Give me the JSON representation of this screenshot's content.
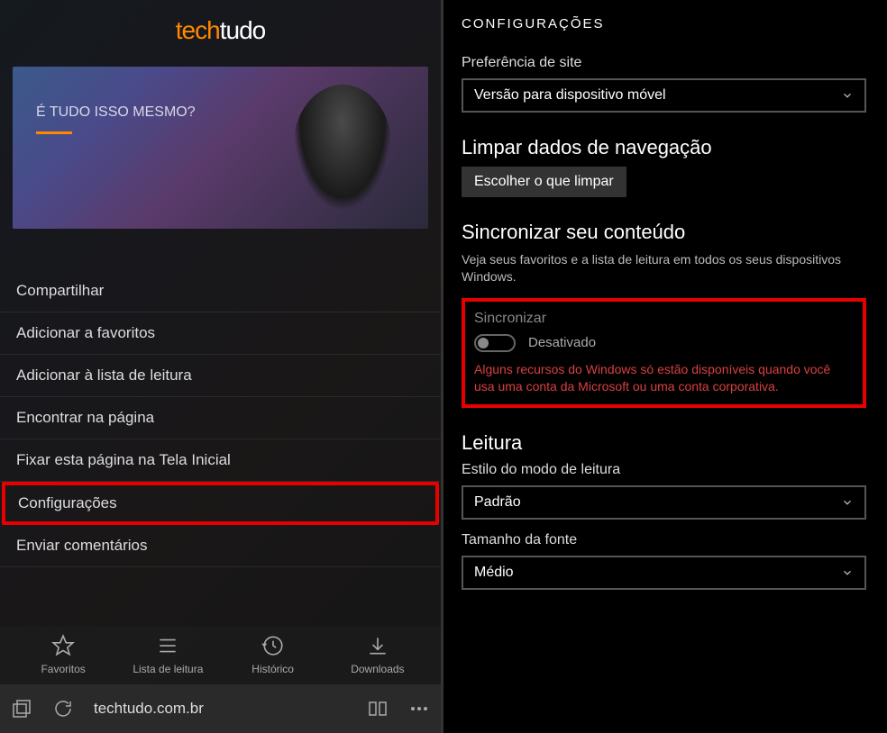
{
  "left": {
    "logo": {
      "tech": "tech",
      "tudo": "tudo"
    },
    "hero_text": "É TUDO ISSO MESMO?",
    "menu": [
      "Compartilhar",
      "Adicionar a favoritos",
      "Adicionar à lista de leitura",
      "Encontrar na página",
      "Fixar esta página na Tela Inicial",
      "Configurações",
      "Enviar comentários"
    ],
    "appbar": {
      "favoritos": "Favoritos",
      "lista": "Lista de leitura",
      "historico": "Histórico",
      "downloads": "Downloads"
    },
    "url": "techtudo.com.br"
  },
  "right": {
    "title": "CONFIGURAÇÕES",
    "site_pref_label": "Preferência de site",
    "site_pref_value": "Versão para dispositivo móvel",
    "clear_heading": "Limpar dados de navegação",
    "clear_button": "Escolher o que limpar",
    "sync_heading": "Sincronizar seu conteúdo",
    "sync_desc": "Veja seus favoritos e a lista de leitura em todos os seus dispositivos Windows.",
    "sync_label": "Sincronizar",
    "sync_state": "Desativado",
    "sync_warning": "Alguns recursos do Windows só estão disponíveis quando você usa uma conta da Microsoft ou uma conta corporativa.",
    "reading_heading": "Leitura",
    "reading_style_label": "Estilo do modo de leitura",
    "reading_style_value": "Padrão",
    "font_size_label": "Tamanho da fonte",
    "font_size_value": "Médio"
  }
}
